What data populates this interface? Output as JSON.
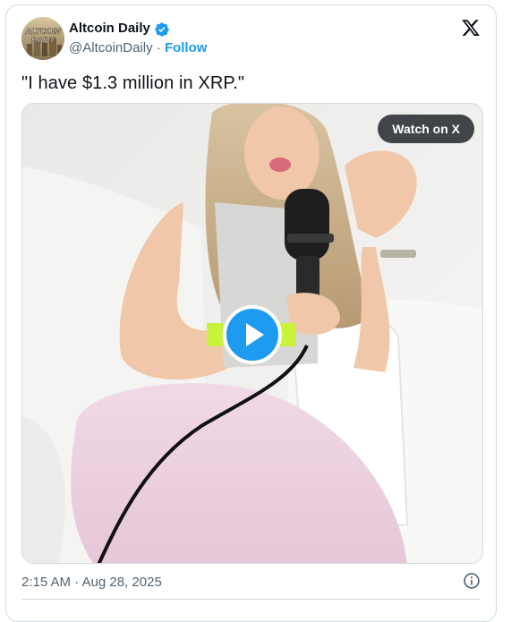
{
  "tweet": {
    "author_name": "Altcoin Daily",
    "avatar_text_line1": "ALTCOIN",
    "avatar_text_line2": "DAILY",
    "handle": "@AltcoinDaily",
    "separator": "·",
    "follow_label": "Follow",
    "text": "\"I have $1.3 million in XRP.\"",
    "timestamp": "2:15 AM · Aug 28, 2025"
  },
  "media": {
    "type": "video",
    "watch_label": "Watch on X"
  },
  "icons": {
    "verified": "verified-badge-icon",
    "logo": "x-logo-icon",
    "play": "play-icon",
    "info": "info-icon"
  },
  "colors": {
    "accent": "#1d9bf0",
    "text": "#0f1419",
    "secondary": "#536471",
    "border": "#cfd9de"
  }
}
